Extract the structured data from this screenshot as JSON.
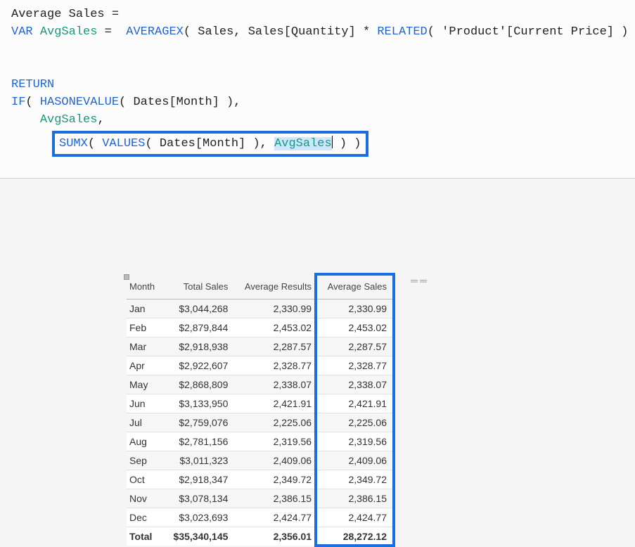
{
  "formula": {
    "measure_name": "Average Sales",
    "eq": "=",
    "line2_prefix": "VAR",
    "line2_var": "AvgSales",
    "line2_eq": "=",
    "line2_fn1": "AVERAGEX",
    "line2_arg1": "Sales",
    "line2_arg2a": "Sales[Quantity]",
    "line2_op": "*",
    "line2_fn2": "RELATED",
    "line2_arg2b": "'Product'[Current Price]",
    "return_kw": "RETURN",
    "if_kw": "IF",
    "hasone_fn": "HASONEVALUE",
    "hasone_arg": "Dates[Month]",
    "avgsales_ref1": "AvgSales",
    "sumx_fn": "SUMX",
    "values_fn": "VALUES",
    "values_arg": "Dates[Month]",
    "avgsales_sel": "AvgSales"
  },
  "table": {
    "headers": [
      "Month",
      "Total Sales",
      "Average Results",
      "Average Sales"
    ],
    "rows": [
      {
        "m": "Jan",
        "ts": "$3,044,268",
        "ar": "2,330.99",
        "as": "2,330.99"
      },
      {
        "m": "Feb",
        "ts": "$2,879,844",
        "ar": "2,453.02",
        "as": "2,453.02"
      },
      {
        "m": "Mar",
        "ts": "$2,918,938",
        "ar": "2,287.57",
        "as": "2,287.57"
      },
      {
        "m": "Apr",
        "ts": "$2,922,607",
        "ar": "2,328.77",
        "as": "2,328.77"
      },
      {
        "m": "May",
        "ts": "$2,868,809",
        "ar": "2,338.07",
        "as": "2,338.07"
      },
      {
        "m": "Jun",
        "ts": "$3,133,950",
        "ar": "2,421.91",
        "as": "2,421.91"
      },
      {
        "m": "Jul",
        "ts": "$2,759,076",
        "ar": "2,225.06",
        "as": "2,225.06"
      },
      {
        "m": "Aug",
        "ts": "$2,781,156",
        "ar": "2,319.56",
        "as": "2,319.56"
      },
      {
        "m": "Sep",
        "ts": "$3,011,323",
        "ar": "2,409.06",
        "as": "2,409.06"
      },
      {
        "m": "Oct",
        "ts": "$2,918,347",
        "ar": "2,349.72",
        "as": "2,349.72"
      },
      {
        "m": "Nov",
        "ts": "$3,078,134",
        "ar": "2,386.15",
        "as": "2,386.15"
      },
      {
        "m": "Dec",
        "ts": "$3,023,693",
        "ar": "2,424.77",
        "as": "2,424.77"
      }
    ],
    "total": {
      "m": "Total",
      "ts": "$35,340,145",
      "ar": "2,356.01",
      "as": "28,272.12"
    }
  }
}
